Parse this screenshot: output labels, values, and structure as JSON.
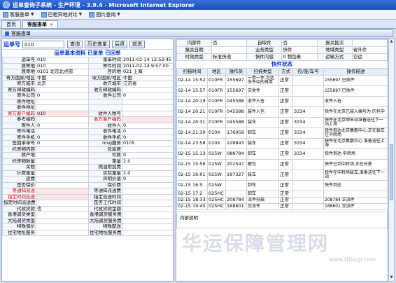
{
  "window": {
    "title": "运单查询子系统 - 生产环境 - 3.9.4 - Microsoft Internet Explorer"
  },
  "menu": [
    {
      "label": "客服查单",
      "icon": "page-icon"
    },
    {
      "label": "巴枪异地对比",
      "icon": "page-icon"
    },
    {
      "label": "图片查询",
      "icon": "image-icon"
    }
  ],
  "tabs": [
    {
      "label": "首页"
    },
    {
      "label": "客服查单"
    }
  ],
  "section_title": "客服查单",
  "search": {
    "label": "运单号",
    "value": "010",
    "buttons": [
      "查询",
      "历史查单",
      "后退",
      "前进"
    ]
  },
  "basic": {
    "title": "运单基本资料",
    "status1": "已录单",
    "status2": "已回单",
    "rows": [
      [
        "运单号",
        "010",
        "录单时间",
        "2011-02-14 12:52:45"
      ],
      [
        "原寄地",
        "010",
        "寄件时间",
        "2011-02-14 9:57:00"
      ],
      [
        "原寄地",
        "0101 北京北点部",
        "目的地",
        "021 上海"
      ],
      [
        "寄方国家/地区",
        "中国",
        "收方国家/地区",
        "中国"
      ],
      [
        "寄方城市",
        "北京",
        "收方城市",
        "江苏省"
      ],
      [
        "寄方邮政编码",
        "",
        "收方邮政编码",
        ""
      ],
      [
        "寄件公司",
        "0",
        "收件公司",
        "0"
      ],
      [
        "寄件地址",
        "",
        "",
        ""
      ],
      [
        "收件地址",
        "",
        "",
        ""
      ],
      [
        "寄方客户编码",
        "010",
        "收件人税号",
        ""
      ],
      [
        "参考编码",
        "",
        "收方客户编码",
        ""
      ],
      [
        "寄件人",
        "0",
        "收件人",
        "0"
      ],
      [
        "寄件电话",
        "",
        "收件电话",
        "0"
      ],
      [
        "寄件手机",
        "0",
        "收件手机",
        "0"
      ],
      [
        "签回单单号",
        "0",
        "msg服务",
        "0105"
      ],
      [
        "托寄物内容",
        "",
        "包装费",
        ""
      ],
      [
        "原产地",
        "",
        "件数",
        "0"
      ],
      [
        "托寄物数量",
        "",
        "重量",
        "2.0"
      ],
      [
        "关税",
        "",
        "燃油附加费",
        ""
      ],
      [
        "计费重量",
        "",
        "实际重量",
        "2.0"
      ],
      [
        "运费",
        "",
        "声明价值",
        "0"
      ],
      [
        "是否保价",
        "",
        "保价费",
        ""
      ],
      [
        "等通知派送",
        "",
        "等通知派送费",
        ""
      ],
      [
        "指定时间派送",
        "",
        "指定派送时间",
        ""
      ],
      [
        "指定时间派送费用",
        "",
        "是否工作时间",
        ""
      ],
      [
        "代收货款",
        "否",
        "代收货款金额",
        ""
      ],
      [
        "香港调货类型",
        "",
        "香港调货服务费",
        ""
      ],
      [
        "大陆调货类型",
        "",
        "大陆调货服务费",
        ""
      ],
      [
        "特殊保价",
        "",
        "特殊配送",
        ""
      ],
      [
        "住宅地址服务",
        "",
        "住宅地址服务费",
        ""
      ]
    ],
    "red_keys": [
      "寄方客户编码",
      "收方客户编码",
      "等通知派送",
      "指定时间派送"
    ]
  },
  "topinfo": {
    "rows": [
      [
        "内部件",
        "否",
        "自取件",
        "否",
        "报关批次",
        ""
      ],
      [
        "报关日期",
        "",
        "业务类型",
        "快件",
        "地域类型",
        "省外件"
      ],
      [
        "时效类型",
        "标准快递",
        "快件内容",
        "0 物包裹",
        "运输方式",
        "空运"
      ]
    ]
  },
  "tracking": {
    "title": "快件状态",
    "columns": [
      "扫描时间",
      "地区",
      "操作员",
      "扫描类型",
      "方式",
      "包/笼/车号",
      "操作描述"
    ],
    "rows": [
      [
        "02-14 15:52",
        "010FR",
        "155697",
        "一票一件,包括多件中的母单",
        "正常",
        "",
        "155697 已收件"
      ],
      [
        "02-14 15:57",
        "010FR",
        "155697",
        "交收件",
        "正常",
        "",
        "155697 已收件"
      ],
      [
        "02-14 20:19",
        "010FR",
        "045588",
        "收件入仓",
        "正常",
        "",
        "收件入仓"
      ],
      [
        "02-14 20:21",
        "010FR",
        "045588",
        "装件入包",
        "正常",
        "3334",
        "快件在北京已装入编号为 的包中"
      ],
      [
        "02-14 20:31",
        "010FR",
        "045588",
        "装车",
        "正常",
        "3334",
        "快件在北京顺丰站准备送往下一站上海"
      ],
      [
        "02-14 21:30",
        "010X",
        "176059",
        "卸车",
        "正常",
        "3334",
        "快件到达北京集散中心,正在装车往中转场"
      ],
      [
        "02-14 23:58",
        "010X",
        "228843",
        "装车",
        "正常",
        "3334",
        "快件在北京集散中心 准备送往上海"
      ],
      [
        "02-15 15:13",
        "025W",
        "088784",
        "卸车",
        "正常",
        "3334",
        "快件到达 中转场"
      ],
      [
        "02-15 15:56",
        "025W",
        "202547",
        "解包",
        "正常",
        "",
        "快件已到中转场,正在分拣"
      ],
      [
        "02-15 16:01",
        "025W",
        "197327",
        "装车",
        "正常",
        "",
        "快件在中转场装车,准备送往下一站"
      ],
      [
        "02-15 16:5",
        "025W",
        "",
        "卸车",
        "正常",
        "",
        "快件到达"
      ],
      [
        "02-15 17:2",
        "025HC",
        "",
        "卸车",
        "正常",
        "",
        ""
      ],
      [
        "02-15 18:33",
        "025HC",
        "208784",
        "派件扫描",
        "正常",
        "",
        "208784 正派件"
      ],
      [
        "02-15 19:45",
        "025HC",
        "168601",
        "交派件",
        "正常",
        "",
        "168601 交派件"
      ]
    ]
  },
  "notes": {
    "label": "内部说明"
  },
  "watermark": {
    "text": "华运保障管理网",
    "url": "www.zbbzgl.com"
  }
}
